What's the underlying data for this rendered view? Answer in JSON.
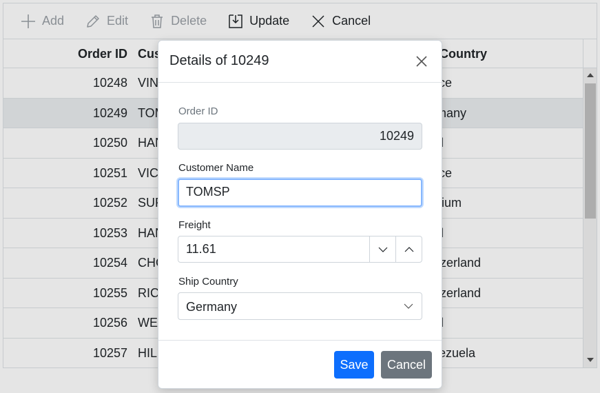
{
  "toolbar": {
    "add_label": "Add",
    "edit_label": "Edit",
    "delete_label": "Delete",
    "update_label": "Update",
    "cancel_label": "Cancel"
  },
  "grid": {
    "columns": [
      "Order ID",
      "Cust",
      "ip Country"
    ],
    "rows": [
      {
        "order_id": "10248",
        "customer": "VIN",
        "country": "ance"
      },
      {
        "order_id": "10249",
        "customer": "TOM",
        "country": "ermany"
      },
      {
        "order_id": "10250",
        "customer": "HAN",
        "country": "azil"
      },
      {
        "order_id": "10251",
        "customer": "VIC",
        "country": "ance"
      },
      {
        "order_id": "10252",
        "customer": "SUF",
        "country": "elgium"
      },
      {
        "order_id": "10253",
        "customer": "HAN",
        "country": "azil"
      },
      {
        "order_id": "10254",
        "customer": "CHO",
        "country": "witzerland"
      },
      {
        "order_id": "10255",
        "customer": "RIC",
        "country": "witzerland"
      },
      {
        "order_id": "10256",
        "customer": "WEL",
        "country": "azil"
      },
      {
        "order_id": "10257",
        "customer": "HIL",
        "country": "enezuela"
      }
    ],
    "selected_index": 1
  },
  "dialog": {
    "title": "Details of 10249",
    "fields": {
      "order_id_label": "Order ID",
      "order_id_value": "10249",
      "customer_label": "Customer Name",
      "customer_value": "TOMSP",
      "freight_label": "Freight",
      "freight_value": "11.61",
      "country_label": "Ship Country",
      "country_value": "Germany"
    },
    "save_label": "Save",
    "cancel_label": "Cancel"
  },
  "colors": {
    "primary": "#0d6efd",
    "secondary": "#6c757d",
    "focus_ring": "#86b7fe"
  }
}
